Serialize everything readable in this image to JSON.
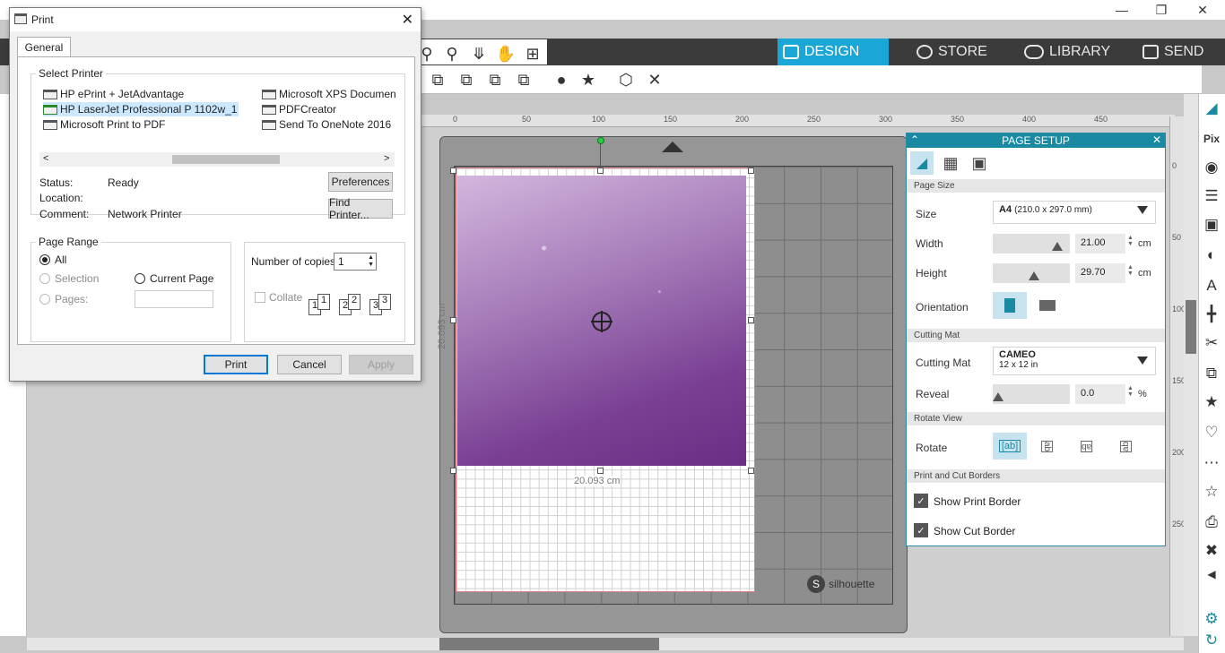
{
  "app": {
    "nav_tabs": [
      {
        "label": "DESIGN",
        "icon": "grid-icon",
        "active": true
      },
      {
        "label": "STORE",
        "icon": "store-icon",
        "active": false
      },
      {
        "label": "LIBRARY",
        "icon": "cloud-icon",
        "active": false
      },
      {
        "label": "SEND",
        "icon": "printer-icon",
        "active": false
      }
    ],
    "accent_color": "#1aa7d8",
    "ruler_ticks": [
      "0",
      "50",
      "100",
      "150",
      "200",
      "250",
      "300",
      "350",
      "400",
      "450"
    ],
    "vruler_ticks": [
      "0",
      "50",
      "100",
      "150",
      "200",
      "250"
    ],
    "canvas": {
      "width_dim": "20.093 cm",
      "height_dim": "20.093 cm",
      "brand": "silhouette"
    }
  },
  "page_setup": {
    "title": "PAGE SETUP",
    "sections": {
      "page_size": "Page Size",
      "cutting_mat": "Cutting Mat",
      "rotate_view": "Rotate View",
      "borders": "Print and Cut Borders"
    },
    "size_label": "Size",
    "size_value": "A4",
    "size_detail": "(210.0 x 297.0 mm)",
    "width_label": "Width",
    "width_value": "21.00",
    "height_label": "Height",
    "height_value": "29.70",
    "unit": "cm",
    "orientation_label": "Orientation",
    "mat_label": "Cutting Mat",
    "mat_value": "CAMEO",
    "mat_detail": "12 x 12 in",
    "reveal_label": "Reveal",
    "reveal_value": "0.0",
    "reveal_unit": "%",
    "rotate_label": "Rotate",
    "show_print_border": "Show Print Border",
    "show_cut_border": "Show Cut Border"
  },
  "print_dialog": {
    "title": "Print",
    "tab": "General",
    "select_printer_label": "Select Printer",
    "printers_left": [
      {
        "name": "HP ePrint + JetAdvantage",
        "selected": false
      },
      {
        "name": "HP LaserJet Professional P 1102w_1",
        "selected": true
      },
      {
        "name": "Microsoft Print to PDF",
        "selected": false
      }
    ],
    "printers_right": [
      {
        "name": "Microsoft XPS Documen",
        "selected": false
      },
      {
        "name": "PDFCreator",
        "selected": false
      },
      {
        "name": "Send To OneNote 2016",
        "selected": false
      }
    ],
    "status_label": "Status:",
    "status_value": "Ready",
    "location_label": "Location:",
    "location_value": "",
    "comment_label": "Comment:",
    "comment_value": "Network Printer",
    "preferences_btn": "Preferences",
    "find_printer_btn": "Find Printer...",
    "page_range_label": "Page Range",
    "range_all": "All",
    "range_selection": "Selection",
    "range_current": "Current Page",
    "range_pages": "Pages:",
    "copies_label": "Number of copies:",
    "copies_value": "1",
    "collate_label": "Collate",
    "print_btn": "Print",
    "cancel_btn": "Cancel",
    "apply_btn": "Apply"
  }
}
